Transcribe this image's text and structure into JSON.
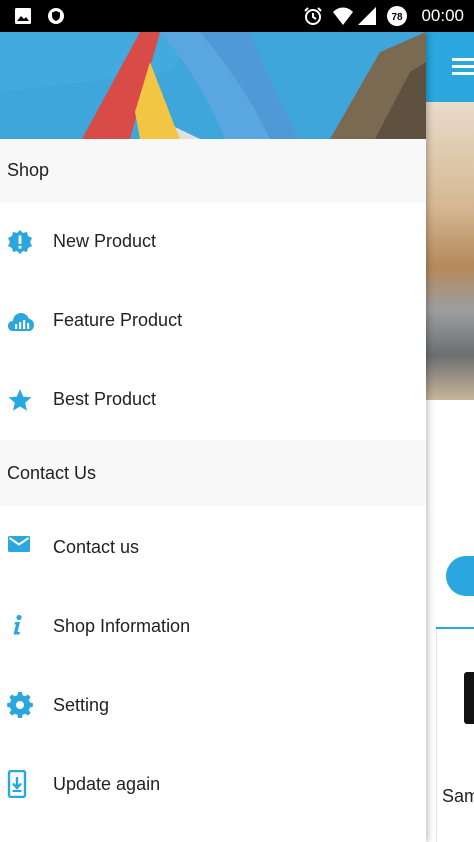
{
  "status_bar": {
    "time": "00:00",
    "battery": "78",
    "icons": [
      "image-icon",
      "vpn-shield-icon",
      "alarm-icon",
      "wifi-icon",
      "signal-icon",
      "battery-icon"
    ]
  },
  "drawer": {
    "sections": [
      {
        "title": "Shop",
        "items": [
          {
            "label": "New Product",
            "icon": "alert-badge-icon"
          },
          {
            "label": "Feature Product",
            "icon": "cloud-chart-icon"
          },
          {
            "label": "Best Product",
            "icon": "star-icon"
          }
        ]
      },
      {
        "title": "Contact Us",
        "items": [
          {
            "label": "Contact us",
            "icon": "mail-icon"
          },
          {
            "label": "Shop Information",
            "icon": "info-icon"
          },
          {
            "label": "Setting",
            "icon": "gear-icon"
          },
          {
            "label": "Update again",
            "icon": "phone-download-icon"
          }
        ]
      }
    ]
  },
  "background_app": {
    "partial_text": "Sam"
  },
  "colors": {
    "accent": "#29a7de",
    "status_bar": "#000000",
    "section_bg": "#f8f8f8",
    "text": "#222222"
  }
}
